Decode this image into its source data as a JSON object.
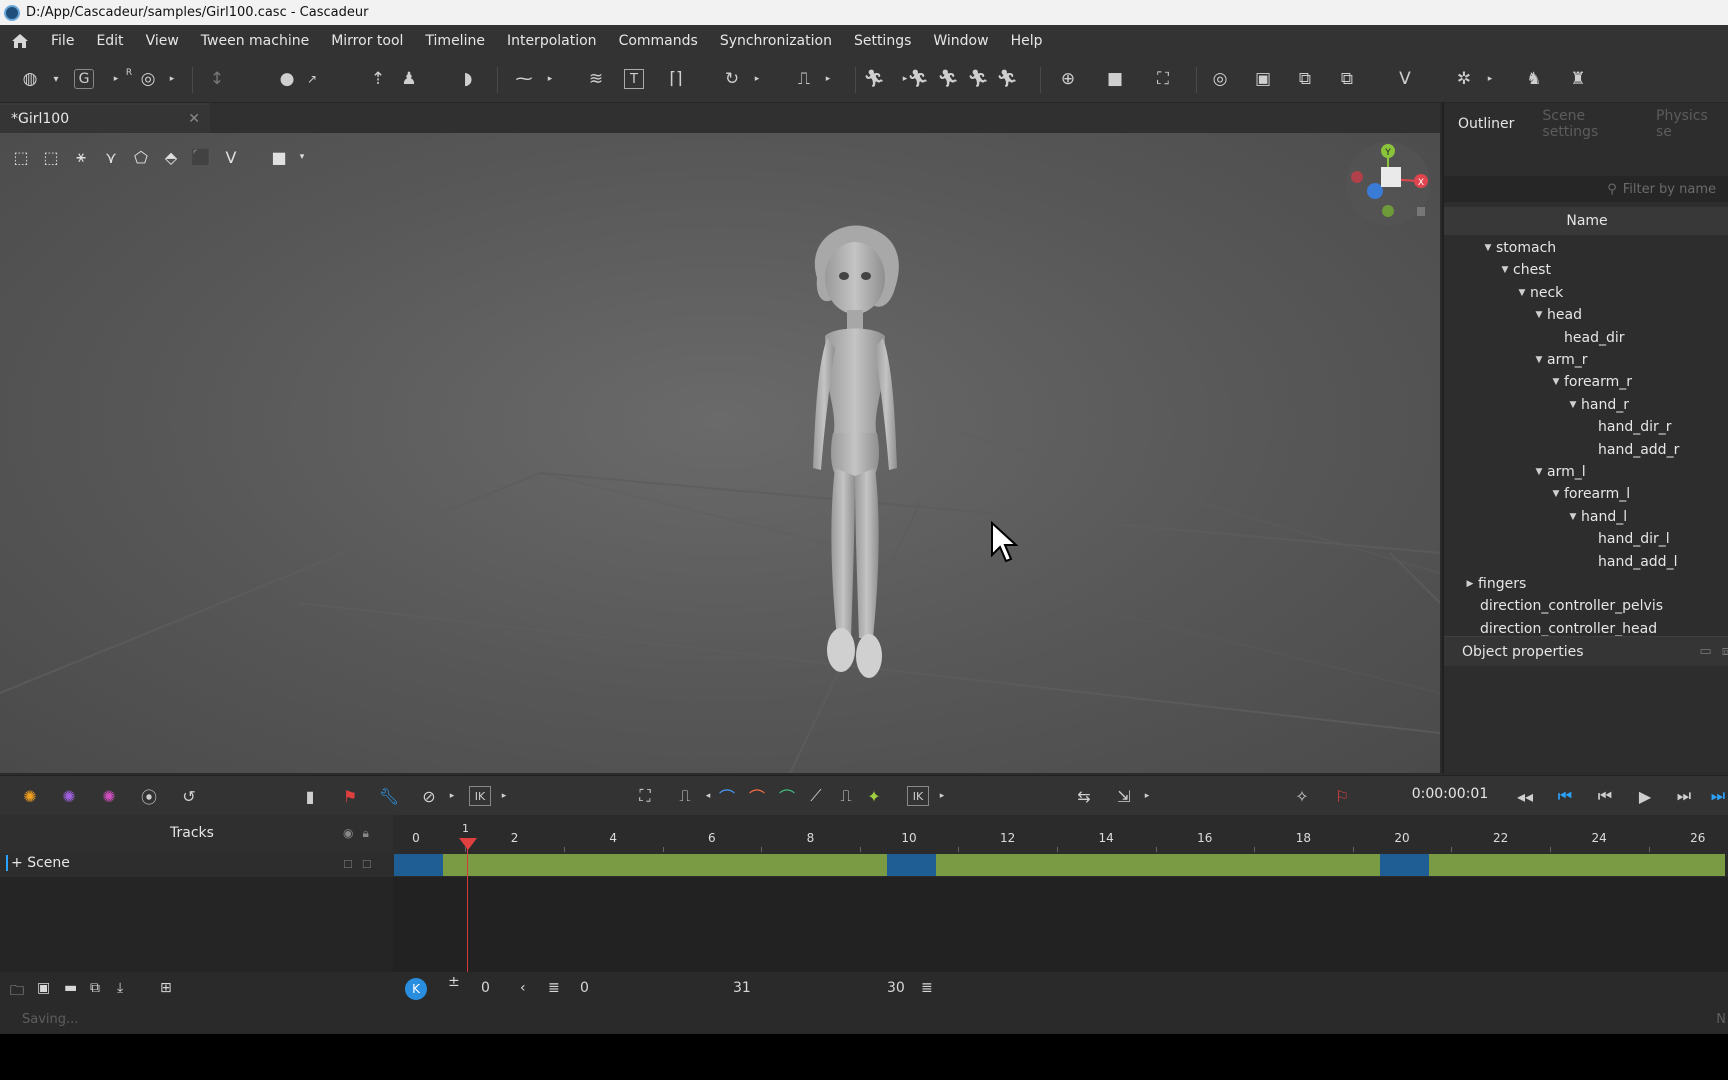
{
  "window": {
    "title": "D:/App/Cascadeur/samples/Girl100.casc - Cascadeur"
  },
  "menu": [
    "File",
    "Edit",
    "View",
    "Tween machine",
    "Mirror tool",
    "Timeline",
    "Interpolation",
    "Commands",
    "Synchronization",
    "Settings",
    "Window",
    "Help"
  ],
  "toolbar": {
    "letter_g": "G",
    "letter_r": "R",
    "letter_t": "T"
  },
  "document": {
    "tab_label": "*Girl100",
    "close_glyph": "✕"
  },
  "gizmo": {
    "y_label": "Y",
    "x_label": "X"
  },
  "right_panel": {
    "tabs": [
      "Outliner",
      "Scene settings",
      "Physics se"
    ],
    "filter_placeholder": "Filter by name",
    "name_header": "Name",
    "tree": [
      {
        "label": "stomach",
        "depth": 0,
        "expanded": true
      },
      {
        "label": "chest",
        "depth": 1,
        "expanded": true
      },
      {
        "label": "neck",
        "depth": 2,
        "expanded": true
      },
      {
        "label": "head",
        "depth": 3,
        "expanded": true
      },
      {
        "label": "head_dir",
        "depth": 4,
        "expanded": null
      },
      {
        "label": "arm_r",
        "depth": 3,
        "expanded": true
      },
      {
        "label": "forearm_r",
        "depth": 4,
        "expanded": true
      },
      {
        "label": "hand_r",
        "depth": 5,
        "expanded": true
      },
      {
        "label": "hand_dir_r",
        "depth": 6,
        "expanded": null
      },
      {
        "label": "hand_add_r",
        "depth": 6,
        "expanded": null
      },
      {
        "label": "arm_l",
        "depth": 3,
        "expanded": true
      },
      {
        "label": "forearm_l",
        "depth": 4,
        "expanded": true
      },
      {
        "label": "hand_l",
        "depth": 5,
        "expanded": true
      },
      {
        "label": "hand_dir_l",
        "depth": 6,
        "expanded": null
      },
      {
        "label": "hand_add_l",
        "depth": 6,
        "expanded": null
      },
      {
        "label": "fingers",
        "depth": -1,
        "expanded": false
      },
      {
        "label": "direction_controller_pelvis",
        "depth": -0.5,
        "expanded": null
      },
      {
        "label": "direction_controller_head",
        "depth": -0.5,
        "expanded": null
      }
    ],
    "object_properties": "Object properties"
  },
  "timeline": {
    "ik_label": "IK",
    "timecode": "0:00:00:01",
    "tracks_label": "Tracks",
    "scene_label": "Scene",
    "playhead_frame": "1",
    "ruler_labels": [
      "0",
      "2",
      "4",
      "6",
      "8",
      "10",
      "12",
      "14",
      "16",
      "18",
      "20",
      "22",
      "24",
      "26"
    ],
    "segments": [
      {
        "kind": "key",
        "start": 0,
        "end": 1
      },
      {
        "kind": "interp",
        "start": 1,
        "end": 10
      },
      {
        "kind": "key",
        "start": 10,
        "end": 11
      },
      {
        "kind": "interp",
        "start": 11,
        "end": 20
      },
      {
        "kind": "key",
        "start": 20,
        "end": 21
      },
      {
        "kind": "interp",
        "start": 21,
        "end": 27
      }
    ],
    "colors": {
      "key": "#1f5d95",
      "interp": "#7a9a44",
      "playhead": "#e04040",
      "accent": "#2aa3ff"
    }
  },
  "bottom": {
    "offset": "0",
    "range_start": "0",
    "range_mid": "31",
    "range_end": "30"
  },
  "status": {
    "text": "Saving...",
    "right_text": "N"
  }
}
